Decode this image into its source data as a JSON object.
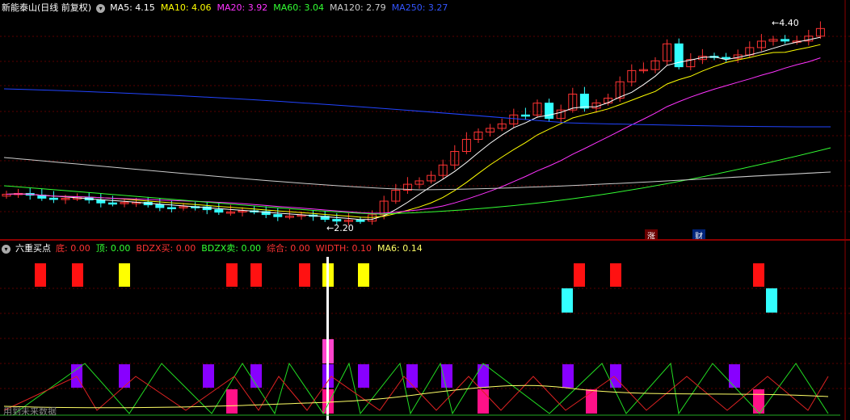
{
  "top": {
    "title": "新能泰山(日线 前复权)",
    "indicators": [
      {
        "label": "MA5: 4.15",
        "color": "#ffffff"
      },
      {
        "label": "MA10: 4.06",
        "color": "#ffff00"
      },
      {
        "label": "MA20: 3.92",
        "color": "#ff33ff"
      },
      {
        "label": "MA60: 3.04",
        "color": "#33ff33"
      },
      {
        "label": "MA120: 2.79",
        "color": "#cccccc"
      },
      {
        "label": "MA250: 3.27",
        "color": "#3355ff"
      }
    ],
    "high_label": "4.40",
    "low_label": "2.20",
    "tag_zhang": "涨",
    "tag_cai": "财"
  },
  "bottom": {
    "title": "六重买点",
    "indicators": [
      {
        "label": "底: 0.00",
        "color": "#ff3333"
      },
      {
        "label": "顶: 0.00",
        "color": "#33ff33"
      },
      {
        "label": "BDZX买: 0.00",
        "color": "#ff3333"
      },
      {
        "label": "BDZX卖: 0.00",
        "color": "#33ff33"
      },
      {
        "label": "综合: 0.00",
        "color": "#ff3333"
      },
      {
        "label": "WIDTH: 0.10",
        "color": "#ff3333"
      },
      {
        "label": "MA6: 0.14",
        "color": "#ffff66"
      }
    ],
    "footer_text": "用到未来数据"
  },
  "colors": {
    "up": "#ff3333",
    "down": "#33ffff",
    "bg": "#000000",
    "grid": "#5a0000"
  },
  "chart_data": {
    "type": "candlestick",
    "price_high": 4.4,
    "price_low": 2.2,
    "red_signal_columns": [
      50,
      96,
      287,
      317,
      377,
      717,
      762,
      939
    ],
    "yellow_signal_columns": [
      154,
      406,
      450
    ],
    "cyan_signal_columns": [
      702,
      955
    ],
    "purple_signal_columns": [
      95,
      154,
      258,
      317,
      406,
      450,
      510,
      553,
      598,
      703,
      762,
      909
    ],
    "pink_signal_columns": [
      287,
      406,
      598,
      732,
      939
    ]
  }
}
